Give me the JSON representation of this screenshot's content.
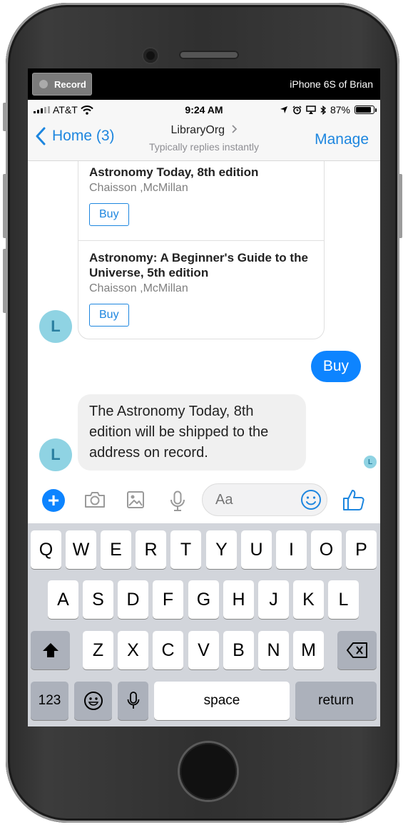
{
  "recording": {
    "button_label": "Record",
    "device_name": "iPhone 6S of Brian"
  },
  "status_bar": {
    "carrier": "AT&T",
    "time": "9:24 AM",
    "battery_percent": "87%",
    "battery_level": 0.87
  },
  "nav": {
    "back_label": "Home (3)",
    "title": "LibraryOrg",
    "subtitle": "Typically replies instantly",
    "manage_label": "Manage"
  },
  "chat": {
    "cards": [
      {
        "title": "Astronomy Today, 8th edition",
        "authors": "Chaisson ,McMillan",
        "button": "Buy"
      },
      {
        "title": "Astronomy: A Beginner's Guide to the Universe, 5th edition",
        "authors": "Chaisson ,McMillan",
        "button": "Buy"
      }
    ],
    "avatar_initial": "L",
    "outgoing_message": "Buy",
    "incoming_message": "The Astronomy Today, 8th edition will be shipped to the address on record.",
    "seen_initial": "L"
  },
  "composer": {
    "placeholder": "Aa"
  },
  "keyboard": {
    "row1": [
      "Q",
      "W",
      "E",
      "R",
      "T",
      "Y",
      "U",
      "I",
      "O",
      "P"
    ],
    "row2": [
      "A",
      "S",
      "D",
      "F",
      "G",
      "H",
      "J",
      "K",
      "L"
    ],
    "row3": [
      "Z",
      "X",
      "C",
      "V",
      "B",
      "N",
      "M"
    ],
    "numbers_label": "123",
    "space_label": "space",
    "return_label": "return"
  },
  "colors": {
    "accent": "#1d86df",
    "outgoing_bubble": "#0d84ff",
    "avatar": "#8fd3e3",
    "keyboard_bg": "#d2d5db"
  }
}
